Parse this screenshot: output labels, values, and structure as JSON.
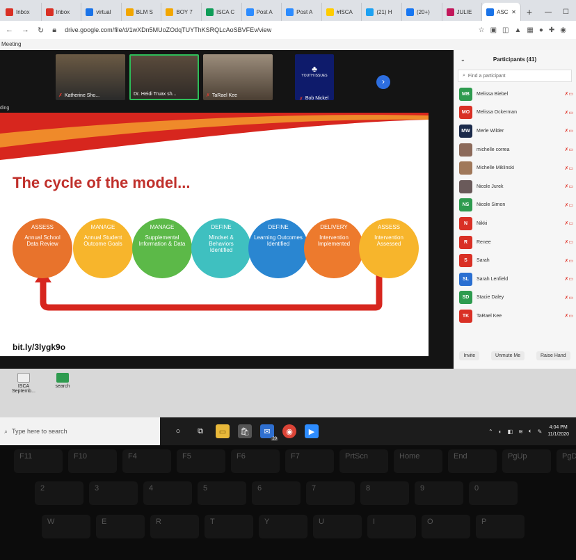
{
  "browser": {
    "tabs": [
      {
        "label": "Inbox",
        "color": "#d93025"
      },
      {
        "label": "Inbox",
        "color": "#d93025"
      },
      {
        "label": "virtual",
        "color": "#1a73e8"
      },
      {
        "label": "BLM S",
        "color": "#f2a600"
      },
      {
        "label": "BOY 7",
        "color": "#f2a600"
      },
      {
        "label": "ISCA C",
        "color": "#0f9d58"
      },
      {
        "label": "Post A",
        "color": "#2d8cff"
      },
      {
        "label": "Post A",
        "color": "#2d8cff"
      },
      {
        "label": "#ISCA",
        "color": "#ffcc00"
      },
      {
        "label": "(21) H",
        "color": "#1da1f2"
      },
      {
        "label": "(20+)",
        "color": "#1877f2"
      },
      {
        "label": "JULIE",
        "color": "#c2185b"
      },
      {
        "label": "ASC",
        "color": "#1a73e8"
      }
    ],
    "new_tab": "+",
    "url": "drive.google.com/file/d/1wXDn5MUoZOdqTUYThKSRQLcAoSBVFEv/view",
    "window_title": "Meeting"
  },
  "meeting": {
    "share_label": "ding",
    "participants_thumbs": [
      {
        "name": "Katherine Sho..."
      },
      {
        "name": "Dr. Heidi Truax sh..."
      },
      {
        "name": "TaRael Kee"
      },
      {
        "name": "Bob Nickel",
        "logo_text": "YOUTH ISSUES"
      }
    ],
    "next_icon": "›"
  },
  "slide": {
    "title": "The cycle of the model...",
    "steps": [
      {
        "title": "ASSESS",
        "desc": "Annual School Data Review"
      },
      {
        "title": "MANAGE",
        "desc": "Annual Student Outcome Goals"
      },
      {
        "title": "MANAGE",
        "desc": "Supplemental Information & Data"
      },
      {
        "title": "DEFINE",
        "desc": "Mindset & Behaviors Identified"
      },
      {
        "title": "DEFINE",
        "desc": "Learning Outcomes Identified"
      },
      {
        "title": "DELIVERY",
        "desc": "Intervention Implemented"
      },
      {
        "title": "ASSESS",
        "desc": "Intervention Assessed"
      }
    ],
    "link": "bit.ly/3lygk9o"
  },
  "participants_panel": {
    "title": "Participants (41)",
    "find_placeholder": "Find a participant",
    "list": [
      {
        "initials": "MB",
        "name": "Melissa Biebel",
        "color": "#2e9b4f"
      },
      {
        "initials": "MO",
        "name": "Melissa Ockerman",
        "color": "#d93025"
      },
      {
        "initials": "MW",
        "name": "Merle Wilder",
        "color": "#1b2a4a"
      },
      {
        "initials": "",
        "name": "michelle correa",
        "color": "#8c6a5a"
      },
      {
        "initials": "",
        "name": "Michelle Miklinski",
        "color": "#a0785a"
      },
      {
        "initials": "",
        "name": "Nicole Jurek",
        "color": "#6a5a5a"
      },
      {
        "initials": "NS",
        "name": "Nicole Simon",
        "color": "#2e9b4f"
      },
      {
        "initials": "N",
        "name": "Nikki",
        "color": "#d93025"
      },
      {
        "initials": "R",
        "name": "Renee",
        "color": "#d93025"
      },
      {
        "initials": "S",
        "name": "Sarah",
        "color": "#d93025"
      },
      {
        "initials": "SL",
        "name": "Sarah Lenfield",
        "color": "#2a6fd1"
      },
      {
        "initials": "SD",
        "name": "Stacie Daley",
        "color": "#2e9b4f"
      },
      {
        "initials": "TK",
        "name": "TaRael Kee",
        "color": "#d93025"
      }
    ],
    "buttons": {
      "invite": "Invite",
      "unmute": "Unmute Me",
      "raise": "Raise Hand"
    }
  },
  "desktop": {
    "icons": [
      {
        "label": "ISCA Septemb..."
      },
      {
        "label": "search"
      }
    ]
  },
  "taskbar": {
    "search_placeholder": "Type here to search",
    "mail_badge": "20",
    "time": "4:04 PM",
    "date": "11/1/2020"
  },
  "keyboard": {
    "row1": [
      "",
      "F11",
      "F10",
      "F4",
      "F5",
      "F6",
      "F7",
      "PrtScn",
      "Home",
      "End",
      "PgUp",
      "PgDn"
    ],
    "row2": [
      "2",
      "3",
      "4",
      "5",
      "6",
      "7",
      "8",
      "9",
      "0"
    ],
    "row3": [
      "W",
      "E",
      "R",
      "T",
      "Y",
      "U",
      "I",
      "O",
      "P"
    ]
  }
}
